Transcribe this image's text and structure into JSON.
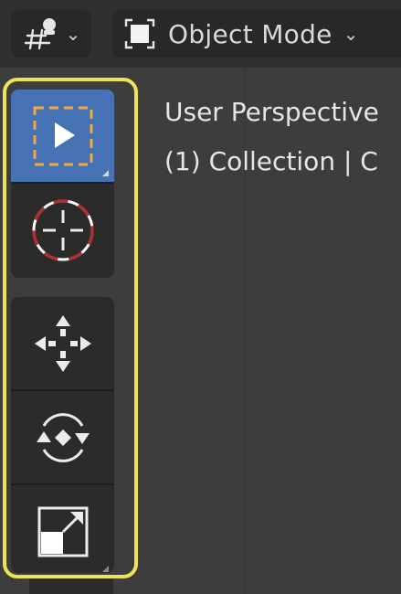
{
  "header": {
    "editor_type_icon": "viewport-gizmo-icon",
    "mode_icon": "object-mode-icon",
    "mode_label": "Object Mode"
  },
  "viewport": {
    "perspective_label": "User Perspective",
    "collection_label": "(1) Collection | C"
  },
  "toolbar": {
    "highlight_color": "#ebe554",
    "active_color": "#4772b3",
    "tools": [
      {
        "name": "select-box",
        "icon": "select-box-icon",
        "active": true
      },
      {
        "name": "cursor",
        "icon": "cursor-icon",
        "active": false
      },
      {
        "name": "move",
        "icon": "move-icon",
        "active": false
      },
      {
        "name": "rotate",
        "icon": "rotate-icon",
        "active": false
      },
      {
        "name": "scale",
        "icon": "scale-icon",
        "active": false
      }
    ]
  }
}
